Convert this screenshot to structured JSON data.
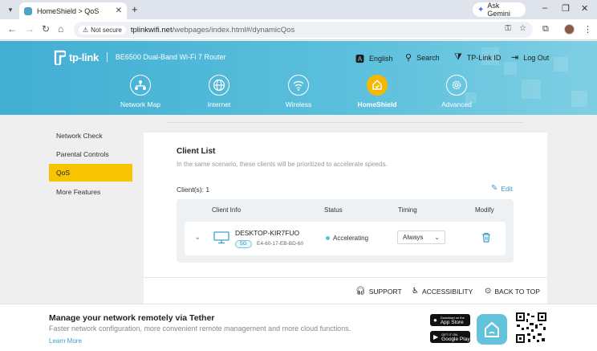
{
  "browser": {
    "tab_title": "HomeShield > QoS",
    "ask_gemini": "Ask Gemini",
    "not_secure": "Not secure",
    "url_host": "tplinkwifi.net",
    "url_path": "/webpages/index.html#/dynamicQos"
  },
  "header": {
    "brand": "tp-link",
    "model": "BE6500 Dual-Band Wi-Fi 7 Router",
    "links": {
      "language": "English",
      "search": "Search",
      "tplink_id": "TP-Link ID",
      "logout": "Log Out"
    },
    "nav": [
      {
        "label": "Network Map",
        "icon": "network-map-icon"
      },
      {
        "label": "Internet",
        "icon": "globe-icon"
      },
      {
        "label": "Wireless",
        "icon": "wifi-icon"
      },
      {
        "label": "HomeShield",
        "icon": "homeshield-icon",
        "active": true
      },
      {
        "label": "Advanced",
        "icon": "gear-icon"
      }
    ],
    "colors": {
      "banner": "#41aed2",
      "active": "#f5b800"
    }
  },
  "sidebar": {
    "items": [
      {
        "label": "Network Check"
      },
      {
        "label": "Parental Controls"
      },
      {
        "label": "QoS",
        "active": true
      },
      {
        "label": "More Features"
      }
    ]
  },
  "client_list": {
    "title": "Client List",
    "subtitle": "In the same scenario, these clients will be prioritized to accelerate speeds.",
    "count_label": "Client(s): 1",
    "edit_label": "Edit",
    "columns": [
      "Client Info",
      "Status",
      "Timing",
      "Modify"
    ],
    "rows": [
      {
        "name": "DESKTOP-KIR7FUO",
        "band": "5G",
        "mac": "E4-60-17-EB-BD-60",
        "status": "Accelerating",
        "timing": "Always"
      }
    ]
  },
  "footer": {
    "support": "SUPPORT",
    "accessibility": "ACCESSIBILITY",
    "back_to_top": "BACK TO TOP"
  },
  "tether": {
    "title": "Manage your network remotely via Tether",
    "subtitle": "Faster network configuration, more convenient remote management and more cloud functions.",
    "learn_more": "Learn More",
    "app_store_small": "Download on the",
    "app_store": "App Store",
    "google_play_small": "GET IT ON",
    "google_play": "Google Play"
  }
}
